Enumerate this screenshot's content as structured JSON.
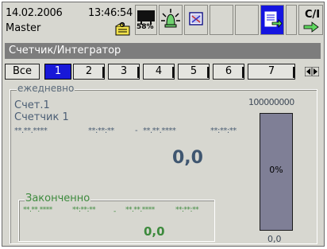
{
  "status": {
    "date": "14.02.2006",
    "time": "13:46:54",
    "user": "Master",
    "memory_percent": "58%"
  },
  "toolbar": {
    "buttons": [
      "memory-card-icon",
      "alarm-bell-icon",
      "screen-info-icon",
      "blank",
      "blank",
      "export-icon",
      "blank",
      "calc-icon"
    ],
    "calc_label": "C/I"
  },
  "window": {
    "title": "Счетчик/Интегратор"
  },
  "tabs": {
    "all_label": "Все",
    "items": [
      "1",
      "2",
      "3",
      "4",
      "5",
      "6",
      "7"
    ],
    "active": "1"
  },
  "daily": {
    "legend": "ежедневно",
    "counter_name": "Счет.1",
    "counter_label": "Счетчик 1",
    "date_from": "**.**.****",
    "time_from": "**:**:**",
    "dash": "-",
    "date_to": "**.**.****",
    "time_to": "**:**:**",
    "value": "0,0",
    "bar_max": "100000000",
    "bar_fill_percent": 0,
    "bar_percent_label": "0%",
    "bar_value": "0,0"
  },
  "finished": {
    "legend": "Законченно",
    "date_from": "**.**.****",
    "time_from": "**:**:**",
    "dash": "-",
    "date_to": "**.**.****",
    "time_to": "**:**:**",
    "value": "0,0"
  },
  "colors": {
    "active_tab": "#1818d8",
    "selected_button": "#1515e0",
    "title_bar": "#7d7d7d",
    "finished_text": "#3d8a3d",
    "value_text": "#3f5670",
    "bar_fill": "#7f7f96"
  }
}
